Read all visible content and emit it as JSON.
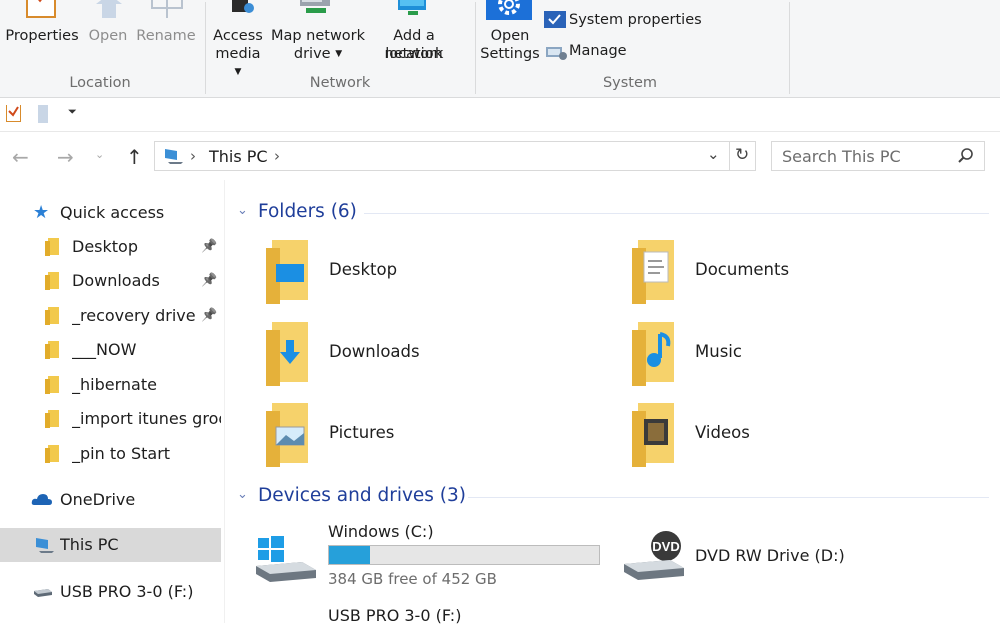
{
  "ribbon": {
    "location": {
      "properties": "Properties",
      "open": "Open",
      "rename": "Rename",
      "group": "Location"
    },
    "network": {
      "access_media_1": "Access",
      "access_media_2": "media",
      "map_drive_1": "Map network",
      "map_drive_2": "drive",
      "add_location_1": "Add a network",
      "add_location_2": "location",
      "group": "Network"
    },
    "system": {
      "open_settings_1": "Open",
      "open_settings_2": "Settings",
      "system_properties": "System properties",
      "manage": "Manage",
      "group": "System"
    }
  },
  "address": {
    "path_item": "This PC",
    "search_placeholder": "Search This PC"
  },
  "nav": {
    "quick_access": "Quick access",
    "items": [
      {
        "label": "Desktop",
        "pinned": true
      },
      {
        "label": "Downloads",
        "pinned": true
      },
      {
        "label": "_recovery drive",
        "pinned": true
      },
      {
        "label": "___NOW",
        "pinned": false
      },
      {
        "label": "_hibernate",
        "pinned": false
      },
      {
        "label": "_import itunes groo",
        "pinned": false
      },
      {
        "label": "_pin to Start",
        "pinned": false
      }
    ],
    "onedrive": "OneDrive",
    "this_pc": "This PC",
    "usb": "USB PRO 3-0 (F:)"
  },
  "content": {
    "folders_header": "Folders (6)",
    "folders": [
      "Desktop",
      "Documents",
      "Downloads",
      "Music",
      "Pictures",
      "Videos"
    ],
    "drives_header": "Devices and drives (3)",
    "drives": [
      {
        "name": "Windows (C:)",
        "free": "384 GB free of 452 GB",
        "used_fraction": 0.15
      },
      {
        "name": "DVD RW Drive (D:)"
      },
      {
        "name": "USB PRO 3-0 (F:)"
      }
    ]
  },
  "colors": {
    "accent": "#1f3e9a",
    "selection": "#d9d9d9",
    "progress": "#26a0da"
  }
}
